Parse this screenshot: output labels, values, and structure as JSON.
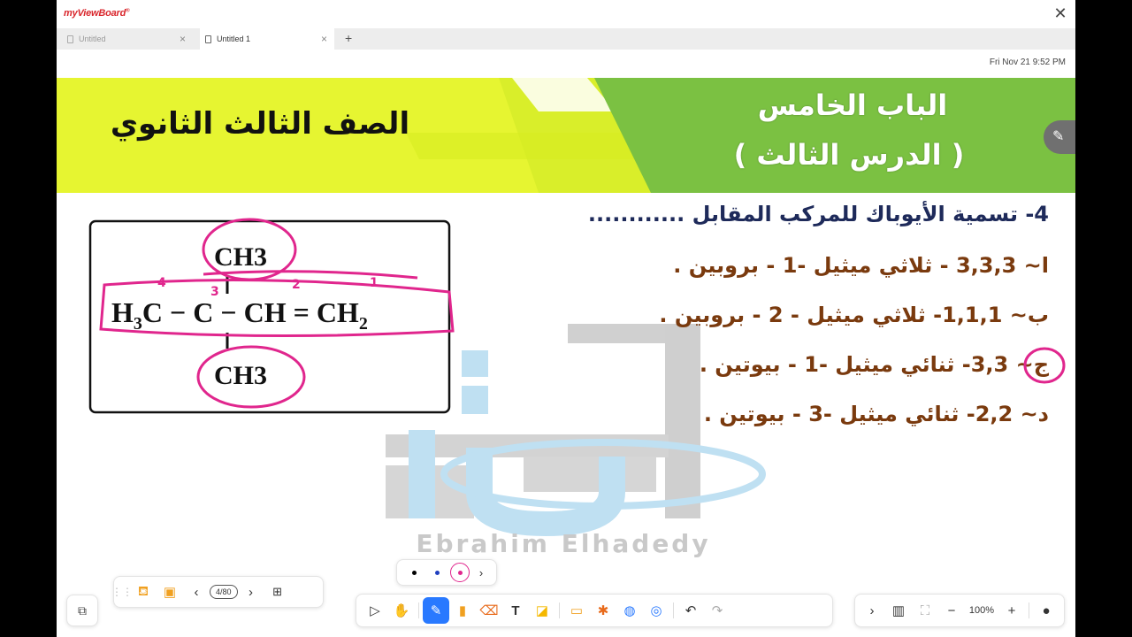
{
  "app": {
    "logo_text": "myViewBoard",
    "close_glyph": "✕"
  },
  "tabs": [
    {
      "label": "Untitled",
      "active": false
    },
    {
      "label": "Untitled 1",
      "active": true
    }
  ],
  "tab_add": "+",
  "datetime": "Fri Nov 21 9:52 PM",
  "slide": {
    "banner_left_title": "الصف الثالث الثانوي",
    "banner_right_line1": "الباب الخامس",
    "banner_right_line2": "( الدرس الثالث )",
    "banner_colors": {
      "yellow": "#e6f531",
      "green": "#7bc142"
    },
    "question": "4- تسمية الأيوباك للمركب المقابل ............",
    "options": [
      "ا~ 3,3,3 - ثلاثي ميثيل -1 - بروبين .",
      "ب~ 1,1,1- ثلاثي ميثيل - 2 - بروبين .",
      "ج~ 3,3- ثنائي ميثيل -1 - بيوتين .",
      "د~ 2,2- ثنائي ميثيل -3 - بيوتين ."
    ],
    "option_color": "#7a3a0e",
    "question_color": "#1e2a5a",
    "structure": {
      "top_group": "CH3",
      "main_chain": [
        "H3C",
        "C",
        "CH",
        "CH2"
      ],
      "bottom_group": "CH3",
      "annotation_numbers": [
        "4",
        "3",
        "2",
        "1"
      ],
      "annotation_color": "#e0268d"
    },
    "watermark": "Ebrahim Elhadedy"
  },
  "toolbar_left": {
    "page_indicator": "4/80"
  },
  "toolbar_right": {
    "zoom": "100%"
  },
  "pen_colors": [
    "#000000",
    "#1f3fbf",
    "#e0268d"
  ]
}
